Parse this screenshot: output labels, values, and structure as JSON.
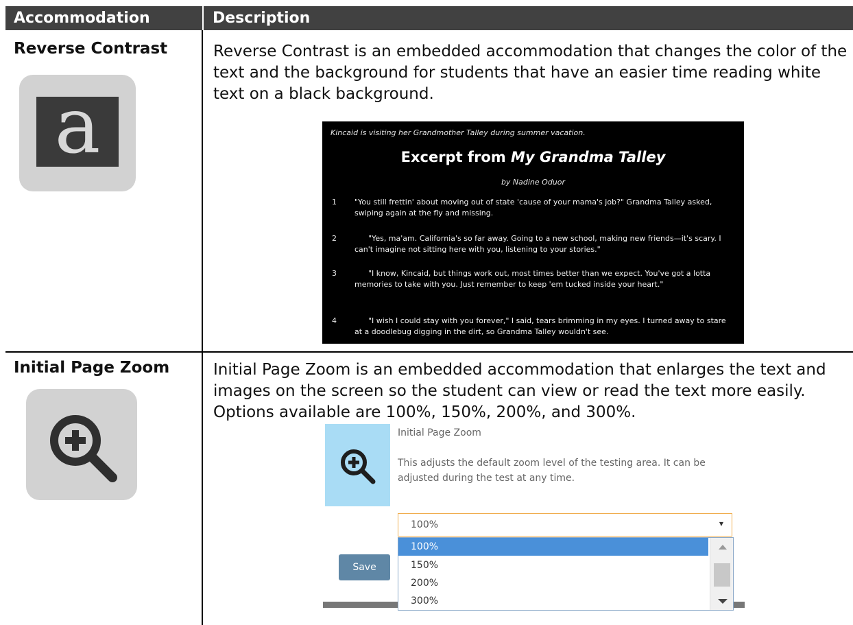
{
  "table": {
    "headers": {
      "accommodation": "Accommodation",
      "description": "Description"
    },
    "rows": [
      {
        "title": "Reverse Contrast",
        "icon": "letter-a-icon",
        "description": "Reverse Contrast is an embedded accommodation that changes the color of the text and the background for students that have an easier time reading white text on a black background."
      },
      {
        "title": "Initial Page Zoom",
        "icon": "zoom-in-icon",
        "description": "Initial Page Zoom is an embedded accommodation that enlarges the text and images on the screen so the student can view or read the text more easily. Options available are 100%, 150%, 200%, and 300%."
      }
    ]
  },
  "reverse_contrast_example": {
    "icon_letter": "a",
    "intro": "Kincaid is visiting her Grandmother Talley during summer vacation.",
    "title_prefix": "Excerpt from",
    "title_italic": "My Grandma Talley",
    "author": "by Nadine Oduor",
    "paragraphs": [
      {
        "num": "1",
        "text": "\"You still frettin' about moving out of state 'cause of your mama's job?\" Grandma Talley asked, swiping again at the fly and missing."
      },
      {
        "num": "2",
        "text": "\"Yes, ma'am. California's so far away. Going to a new school, making new friends—it's scary. I can't imagine not sitting here with you, listening to your stories.\""
      },
      {
        "num": "3",
        "text": "\"I know, Kincaid, but things work out, most times better than we expect. You've got a lotta memories to take with you. Just remember to keep 'em tucked inside your heart.\""
      },
      {
        "num": "4",
        "text": "\"I wish I could stay with you forever,\" I said, tears brimming in my eyes. I turned away to stare at a doodlebug digging in the dirt, so Grandma Talley wouldn't see."
      }
    ]
  },
  "zoom_example": {
    "title": "Initial Page Zoom",
    "text": "This adjusts the default zoom level of the testing area. It can be adjusted during the test at any time.",
    "selected": "100%",
    "options": [
      "100%",
      "150%",
      "200%",
      "300%"
    ],
    "save_label": "Save"
  }
}
